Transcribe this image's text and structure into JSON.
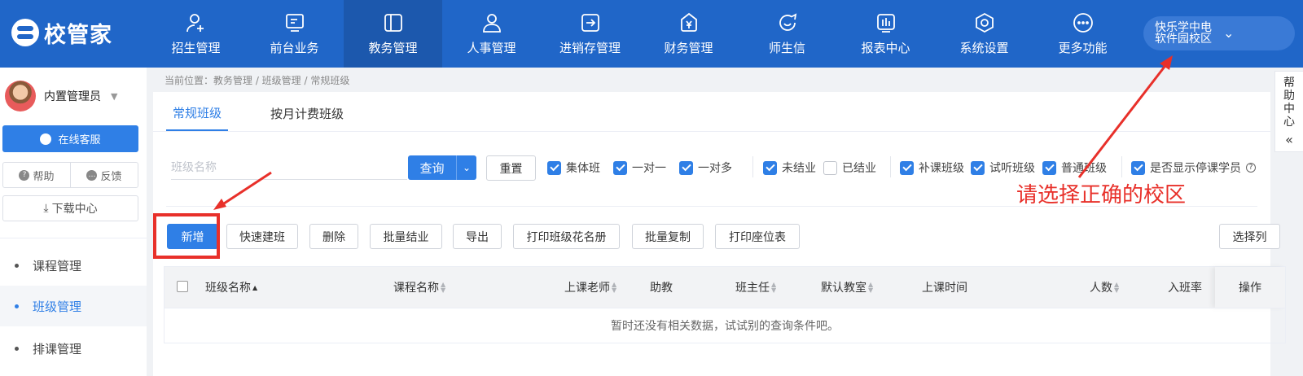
{
  "app": {
    "logo_text": "校管家"
  },
  "nav": [
    {
      "label": "招生管理",
      "icon": "person-add-icon"
    },
    {
      "label": "前台业务",
      "icon": "board-icon"
    },
    {
      "label": "教务管理",
      "icon": "panel-icon",
      "active": true
    },
    {
      "label": "人事管理",
      "icon": "person-icon"
    },
    {
      "label": "进销存管理",
      "icon": "arrow-box-icon"
    },
    {
      "label": "财务管理",
      "icon": "yen-shield-icon"
    },
    {
      "label": "师生信",
      "icon": "chat-bubble-icon"
    },
    {
      "label": "报表中心",
      "icon": "bar-chart-icon"
    },
    {
      "label": "系统设置",
      "icon": "hexagon-settings-icon"
    },
    {
      "label": "更多功能",
      "icon": "more-dots-icon"
    }
  ],
  "campus": {
    "label": "快乐学中电软件园校区"
  },
  "sidebar": {
    "user_name": "内置管理员",
    "online_service": "在线客服",
    "help": "帮助",
    "feedback": "反馈",
    "download": "下载中心",
    "menu": [
      {
        "label": "课程管理"
      },
      {
        "label": "班级管理",
        "active": true
      },
      {
        "label": "排课管理"
      }
    ]
  },
  "breadcrumb": "当前位置：教务管理 / 班级管理 / 常规班级",
  "tabs": [
    {
      "label": "常规班级",
      "active": true
    },
    {
      "label": "按月计费班级"
    }
  ],
  "filters": {
    "class_name_placeholder": "班级名称",
    "query": "查询",
    "reset": "重置",
    "checkboxes": [
      {
        "label": "集体班",
        "checked": true
      },
      {
        "label": "一对一",
        "checked": true
      },
      {
        "label": "一对多",
        "checked": true
      },
      {
        "label": "未结业",
        "checked": true
      },
      {
        "label": "已结业",
        "checked": false
      },
      {
        "label": "补课班级",
        "checked": true
      },
      {
        "label": "试听班级",
        "checked": true
      },
      {
        "label": "普通班级",
        "checked": true
      },
      {
        "label": "是否显示停课学员",
        "checked": true
      }
    ]
  },
  "toolbar": {
    "add": "新增",
    "quick_create": "快速建班",
    "delete": "删除",
    "batch_graduate": "批量结业",
    "export": "导出",
    "print_roster": "打印班级花名册",
    "batch_copy": "批量复制",
    "print_seats": "打印座位表",
    "select_columns": "选择列"
  },
  "table": {
    "columns": [
      "班级名称",
      "课程名称",
      "上课老师",
      "助教",
      "班主任",
      "默认教室",
      "上课时间",
      "人数",
      "入班率",
      "操作"
    ],
    "empty_text": "暂时还没有相关数据，试试别的查询条件吧。"
  },
  "help_center": {
    "chars": [
      "帮",
      "助",
      "中",
      "心"
    ],
    "collapse": "«"
  },
  "annotation": {
    "text": "请选择正确的校区",
    "color": "#e8302a"
  },
  "colors": {
    "nav_bg": "#2066c8",
    "primary": "#2f7fe6",
    "highlight": "#e8302a"
  }
}
